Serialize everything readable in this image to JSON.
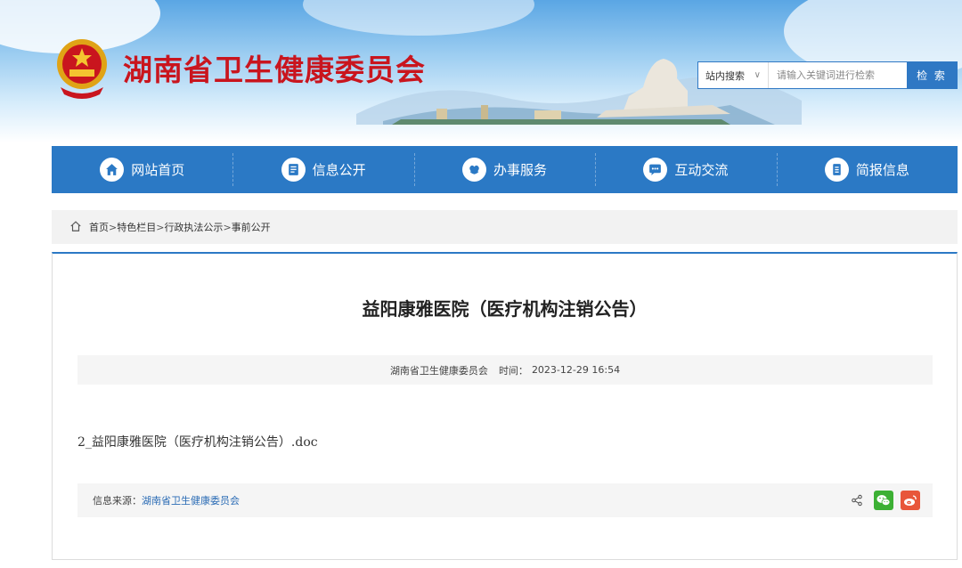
{
  "header": {
    "site_title": "湖南省卫生健康委员会",
    "search": {
      "scope_label": "站内搜索",
      "placeholder": "请输入关键词进行检索",
      "button_label": "检 索"
    }
  },
  "nav": {
    "items": [
      {
        "label": "网站首页",
        "icon": "home-icon"
      },
      {
        "label": "信息公开",
        "icon": "document-list-icon"
      },
      {
        "label": "办事服务",
        "icon": "heart-hands-icon"
      },
      {
        "label": "互动交流",
        "icon": "chat-bubble-icon"
      },
      {
        "label": "简报信息",
        "icon": "report-icon"
      }
    ],
    "accent_color": "#2b79c5"
  },
  "breadcrumb": {
    "items": [
      "首页",
      "特色栏目",
      "行政执法公示",
      "事前公开"
    ],
    "separator": ">"
  },
  "article": {
    "title": "益阳康雅医院（医疗机构注销公告）",
    "publisher": "湖南省卫生健康委员会",
    "time_label": "时间：",
    "time_value": "2023-12-29 16:54",
    "attachment": "2_益阳康雅医院（医疗机构注销公告）.doc",
    "source_label": "信息来源：",
    "source_value": "湖南省卫生健康委员会"
  },
  "share": {
    "icons": [
      "share-icon",
      "wechat-icon",
      "weibo-icon"
    ]
  },
  "colors": {
    "title_red": "#c9151e",
    "wechat_green": "#3cb034",
    "weibo_orange": "#e8563a"
  }
}
